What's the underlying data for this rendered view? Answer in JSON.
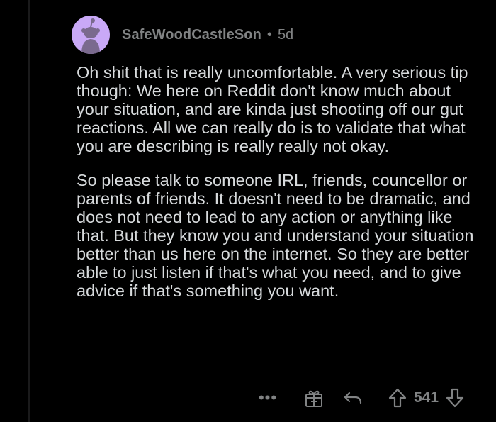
{
  "comment": {
    "author": "SafeWoodCastleSon",
    "separator": "•",
    "age": "5d",
    "paragraphs": [
      "Oh shit that is really uncomfortable. A very serious tip though: We here on Reddit don't know much about your situation, and are kinda just shooting off our gut reactions. All we can really do is to validate that what you are describing is really really not okay.",
      "So please talk to someone IRL, friends, councellor or parents of friends. It doesn't need to be dramatic, and does not need to lead to any action or anything like that. But they know you and understand your situation better than us here on the internet. So they are better able to just listen if that's what you need, and to give advice if that's something you want."
    ],
    "score": "541",
    "more_label": "•••"
  },
  "icons": {
    "avatar": "reddit-snoo-avatar",
    "more": "more-options-icon",
    "award": "award-gift-icon",
    "reply": "reply-arrow-icon",
    "upvote": "upvote-arrow-icon",
    "downvote": "downvote-arrow-icon"
  },
  "colors": {
    "background": "#000000",
    "text": "#d7dadc",
    "meta": "#818384",
    "avatar_bg": "#c9a9f7",
    "snoo": "#7a6a8e"
  }
}
